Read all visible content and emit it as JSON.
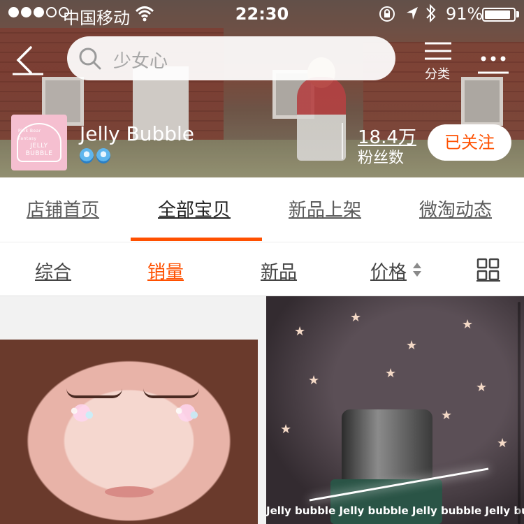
{
  "status_bar": {
    "carrier": "中国移动",
    "time": "22:30",
    "battery_percent": "91%",
    "battery_level": 0.91
  },
  "nav": {
    "search_placeholder": "少女心",
    "category_label": "分类"
  },
  "shop": {
    "name": "Jelly Bubble",
    "logo_text": [
      "Pink Bear Fantasy",
      "JELLY",
      "BUBBLE"
    ],
    "fans_count": "18.4万",
    "fans_label": "粉丝数",
    "follow_label": "已关注"
  },
  "tabs": [
    {
      "label": "店铺首页",
      "active": false
    },
    {
      "label": "全部宝贝",
      "active": true
    },
    {
      "label": "新品上架",
      "active": false
    },
    {
      "label": "微淘动态",
      "active": false
    }
  ],
  "sort": {
    "options": [
      "综合",
      "销量",
      "新品",
      "价格"
    ],
    "active": "销量"
  },
  "products": [
    {
      "watermark": ""
    },
    {
      "watermark": "Jelly bubble Jelly bubble Jelly bubble Jelly bubble"
    }
  ],
  "colors": {
    "accent": "#ff5000"
  }
}
